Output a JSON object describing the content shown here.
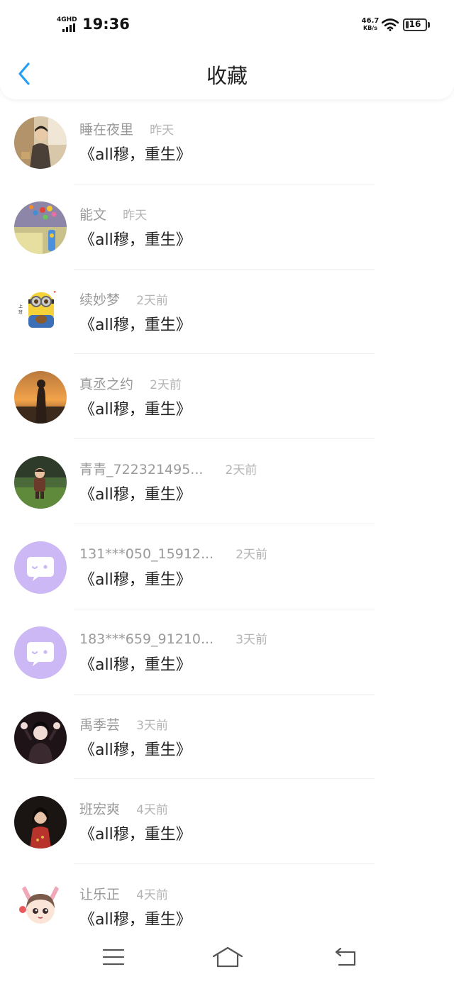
{
  "status_bar": {
    "network": "4GHD",
    "time": "19:36",
    "speed_value": "46.7",
    "speed_unit": "KB/s",
    "battery": "16"
  },
  "header": {
    "title": "收藏",
    "back_icon": "chevron-left-icon"
  },
  "colors": {
    "accent": "#2a9df4",
    "name_text": "#9a9a9a",
    "time_text": "#b4b4b4",
    "title_text": "#222222",
    "default_avatar": "#cbb8f4"
  },
  "favorites": [
    {
      "name": "睡在夜里",
      "time": "昨天",
      "work": "《all穆，重生》",
      "avatar": "photo-avatar-man"
    },
    {
      "name": "能文",
      "time": "昨天",
      "work": "《all穆，重生》",
      "avatar": "flowers-avatar"
    },
    {
      "name": "续妙梦",
      "time": "2天前",
      "work": "《all穆，重生》",
      "avatar": "minion-avatar"
    },
    {
      "name": "真丞之约",
      "time": "2天前",
      "work": "《all穆，重生》",
      "avatar": "sunset-avatar"
    },
    {
      "name": "青青_722321495...",
      "time": "2天前",
      "work": "《all穆，重生》",
      "avatar": "child-grass-avatar"
    },
    {
      "name": "131***050_15912...",
      "time": "2天前",
      "work": "《all穆，重生》",
      "avatar": "default-chat-avatar"
    },
    {
      "name": "183***659_91210...",
      "time": "3天前",
      "work": "《all穆，重生》",
      "avatar": "default-chat-avatar"
    },
    {
      "name": "禹季芸",
      "time": "3天前",
      "work": "《all穆，重生》",
      "avatar": "dark-portrait-avatar"
    },
    {
      "name": "班宏爽",
      "time": "4天前",
      "work": "《all穆，重生》",
      "avatar": "red-dress-avatar"
    },
    {
      "name": "让乐正",
      "time": "4天前",
      "work": "《all穆，重生》",
      "avatar": "cartoon-girl-avatar"
    }
  ],
  "nav_bar": {
    "buttons": [
      "menu-icon",
      "home-icon",
      "back-nav-icon"
    ]
  }
}
